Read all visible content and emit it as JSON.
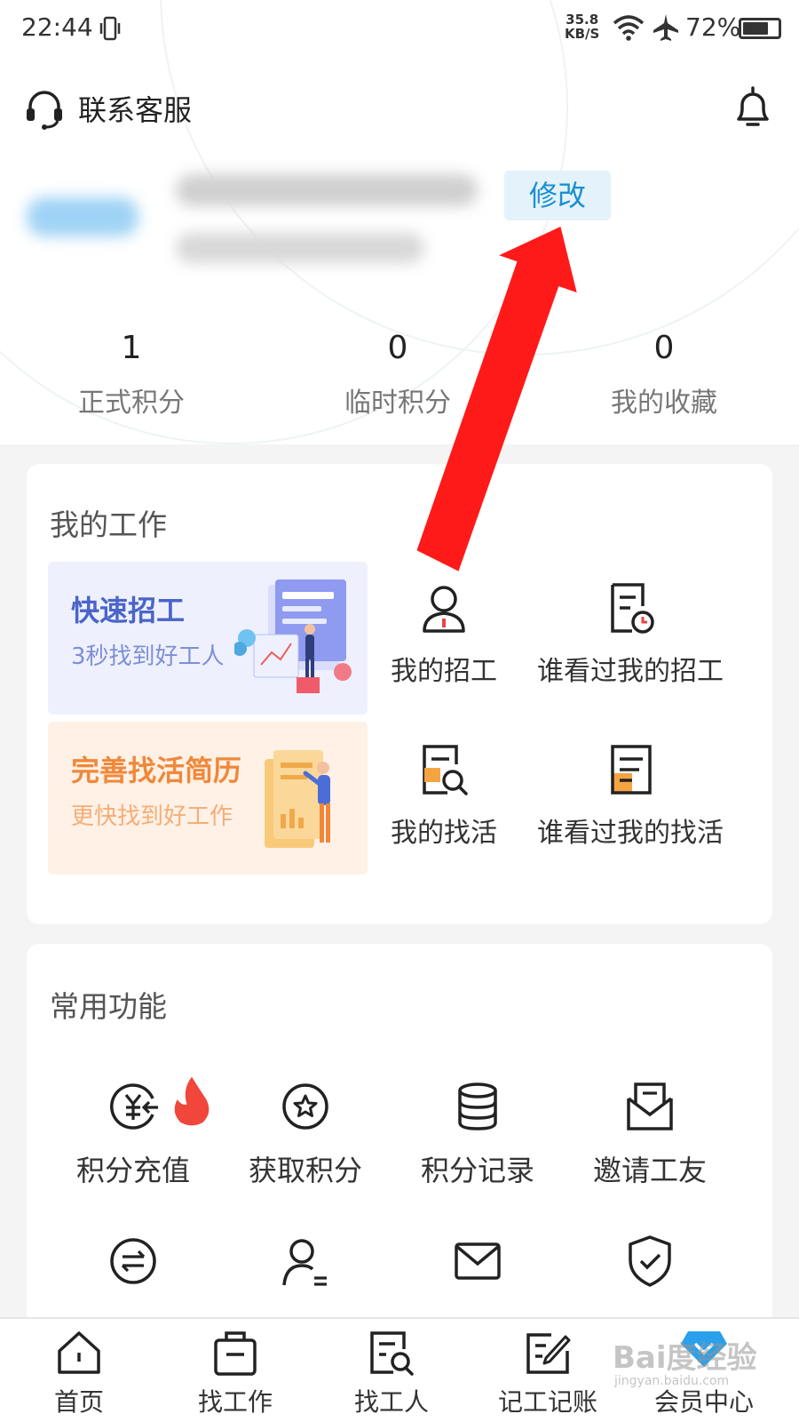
{
  "status_bar": {
    "time": "22:44",
    "speed_value": "35.8",
    "speed_unit": "KB/S",
    "battery": "72%"
  },
  "header": {
    "service_label": "联系客服"
  },
  "profile": {
    "edit_label": "修改"
  },
  "stats": [
    {
      "value": "1",
      "label": "正式积分"
    },
    {
      "value": "0",
      "label": "临时积分"
    },
    {
      "value": "0",
      "label": "我的收藏"
    }
  ],
  "my_work": {
    "title": "我的工作",
    "promo_recruit": {
      "title": "快速招工",
      "subtitle": "3秒找到好工人"
    },
    "promo_resume": {
      "title": "完善找活简历",
      "subtitle": "更快找到好工作"
    },
    "items": [
      {
        "label": "我的招工"
      },
      {
        "label": "谁看过我的招工"
      },
      {
        "label": "我的找活"
      },
      {
        "label": "谁看过我的找活"
      }
    ]
  },
  "functions": {
    "title": "常用功能",
    "items": [
      {
        "label": "积分充值"
      },
      {
        "label": "获取积分"
      },
      {
        "label": "积分记录"
      },
      {
        "label": "邀请工友"
      }
    ]
  },
  "tabbar": [
    {
      "label": "首页"
    },
    {
      "label": "找工作"
    },
    {
      "label": "找工人"
    },
    {
      "label": "记工记账"
    },
    {
      "label": "会员中心"
    }
  ],
  "watermark": {
    "text": "Bai度经验",
    "url": "jingyan.baidu.com"
  },
  "colors": {
    "accent_blue": "#1a8fd0",
    "promo_blue": "#4a64c8",
    "promo_orange": "#f0883a",
    "annotation_red": "#ff1a1a"
  }
}
